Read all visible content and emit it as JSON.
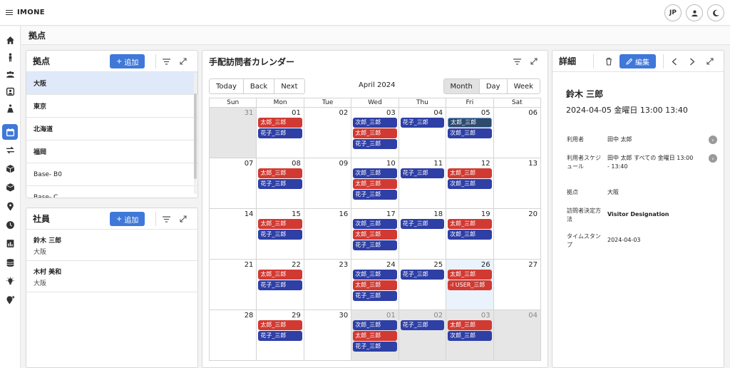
{
  "app": {
    "title": "IMONE",
    "lang_button": "JP"
  },
  "breadcrumb": "拠点",
  "bases_panel": {
    "title": "拠点",
    "add_label": "追加",
    "items": [
      "大阪",
      "東京",
      "北海道",
      "福岡",
      "Base- B0",
      "Base- C"
    ]
  },
  "staff_panel": {
    "title": "社員",
    "add_label": "追加",
    "items": [
      {
        "name": "鈴木 三郎",
        "base": "大阪"
      },
      {
        "name": "木村 美和",
        "base": "大阪"
      }
    ]
  },
  "calendar": {
    "title": "手配訪問者カレンダー",
    "nav": [
      "Today",
      "Back",
      "Next"
    ],
    "month_label": "April 2024",
    "views": [
      "Month",
      "Day",
      "Week"
    ],
    "active_view": "Month",
    "weekdays": [
      "Sun",
      "Mon",
      "Tue",
      "Wed",
      "Thu",
      "Fri",
      "Sat"
    ],
    "weeks": [
      [
        {
          "day": "31",
          "other": true,
          "events": []
        },
        {
          "day": "01",
          "events": [
            {
              "text": "太郎_三郎",
              "color": "red"
            },
            {
              "text": "花子_三郎",
              "color": "blue"
            }
          ]
        },
        {
          "day": "02",
          "events": []
        },
        {
          "day": "03",
          "events": [
            {
              "text": "次郎_三郎",
              "color": "blue"
            },
            {
              "text": "太郎_三郎",
              "color": "red"
            },
            {
              "text": "花子_三郎",
              "color": "blue"
            }
          ]
        },
        {
          "day": "04",
          "events": [
            {
              "text": "花子_三郎",
              "color": "blue"
            }
          ]
        },
        {
          "day": "05",
          "events": [
            {
              "text": "太郎_三郎",
              "color": "dark"
            },
            {
              "text": "次郎_三郎",
              "color": "blue"
            }
          ]
        },
        {
          "day": "06",
          "events": []
        }
      ],
      [
        {
          "day": "07",
          "events": []
        },
        {
          "day": "08",
          "events": [
            {
              "text": "太郎_三郎",
              "color": "red"
            },
            {
              "text": "花子_三郎",
              "color": "blue"
            }
          ]
        },
        {
          "day": "09",
          "events": []
        },
        {
          "day": "10",
          "events": [
            {
              "text": "次郎_三郎",
              "color": "blue"
            },
            {
              "text": "太郎_三郎",
              "color": "red"
            },
            {
              "text": "花子_三郎",
              "color": "blue"
            }
          ]
        },
        {
          "day": "11",
          "events": [
            {
              "text": "花子_三郎",
              "color": "blue"
            }
          ]
        },
        {
          "day": "12",
          "events": [
            {
              "text": "太郎_三郎",
              "color": "red"
            },
            {
              "text": "次郎_三郎",
              "color": "blue"
            }
          ]
        },
        {
          "day": "13",
          "events": []
        }
      ],
      [
        {
          "day": "14",
          "events": []
        },
        {
          "day": "15",
          "events": [
            {
              "text": "太郎_三郎",
              "color": "red"
            },
            {
              "text": "花子_三郎",
              "color": "blue"
            }
          ]
        },
        {
          "day": "16",
          "events": []
        },
        {
          "day": "17",
          "events": [
            {
              "text": "次郎_三郎",
              "color": "blue"
            },
            {
              "text": "太郎_三郎",
              "color": "red"
            },
            {
              "text": "花子_三郎",
              "color": "blue"
            }
          ]
        },
        {
          "day": "18",
          "events": [
            {
              "text": "花子_三郎",
              "color": "blue"
            }
          ]
        },
        {
          "day": "19",
          "events": [
            {
              "text": "太郎_三郎",
              "color": "red"
            },
            {
              "text": "次郎_三郎",
              "color": "blue"
            }
          ]
        },
        {
          "day": "20",
          "events": []
        }
      ],
      [
        {
          "day": "21",
          "events": []
        },
        {
          "day": "22",
          "events": [
            {
              "text": "太郎_三郎",
              "color": "red"
            },
            {
              "text": "花子_三郎",
              "color": "blue"
            }
          ]
        },
        {
          "day": "23",
          "events": []
        },
        {
          "day": "24",
          "events": [
            {
              "text": "次郎_三郎",
              "color": "blue"
            },
            {
              "text": "太郎_三郎",
              "color": "red"
            },
            {
              "text": "花子_三郎",
              "color": "blue"
            }
          ]
        },
        {
          "day": "25",
          "events": [
            {
              "text": "花子_三郎",
              "color": "blue"
            }
          ]
        },
        {
          "day": "26",
          "today": true,
          "events": [
            {
              "text": "太郎_三郎",
              "color": "red"
            },
            {
              "text": "-l USER_三郎",
              "color": "red"
            }
          ]
        },
        {
          "day": "27",
          "events": []
        }
      ],
      [
        {
          "day": "28",
          "events": []
        },
        {
          "day": "29",
          "events": [
            {
              "text": "太郎_三郎",
              "color": "red"
            },
            {
              "text": "花子_三郎",
              "color": "blue"
            }
          ]
        },
        {
          "day": "30",
          "events": []
        },
        {
          "day": "01",
          "other": true,
          "events": [
            {
              "text": "次郎_三郎",
              "color": "blue"
            },
            {
              "text": "太郎_三郎",
              "color": "red"
            },
            {
              "text": "花子_三郎",
              "color": "blue"
            }
          ]
        },
        {
          "day": "02",
          "other": true,
          "events": [
            {
              "text": "花子_三郎",
              "color": "blue"
            }
          ]
        },
        {
          "day": "03",
          "other": true,
          "events": [
            {
              "text": "太郎_三郎",
              "color": "red"
            },
            {
              "text": "次郎_三郎",
              "color": "blue"
            }
          ]
        },
        {
          "day": "04",
          "other": true,
          "events": []
        }
      ]
    ]
  },
  "detail": {
    "title": "詳細",
    "edit_label": "編集",
    "name": "鈴木 三郎",
    "datetime": "2024-04-05 金曜日 13:00 13:40",
    "fields": [
      {
        "label": "利用者",
        "value": "田中 太郎",
        "has_button": true
      },
      {
        "label": "利用者スケジュール",
        "value": "田中 太郎 すべての 金曜日 13:00 - 13:40",
        "has_button": true
      },
      {
        "label": "拠点",
        "value": "大阪",
        "has_button": false
      },
      {
        "label": "訪問者決定方法",
        "value": "Visitor Designation",
        "has_button": false,
        "bold": true
      },
      {
        "label": "タイムスタンプ",
        "value": "2024-04-03",
        "has_button": false
      }
    ]
  },
  "colors": {
    "accent": "#3f78d8",
    "event_red": "#d13a32",
    "event_blue": "#2e3fa6",
    "selected_row": "#dfe9f9"
  }
}
